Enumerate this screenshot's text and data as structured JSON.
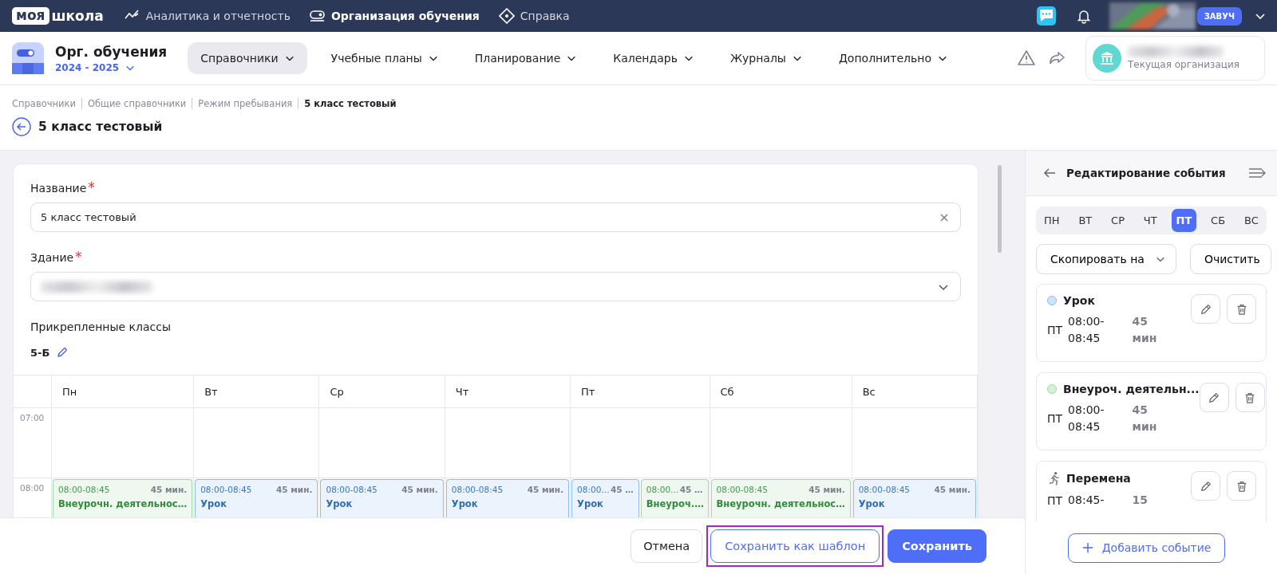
{
  "topbar": {
    "logo": {
      "part_1": "моя",
      "part_2": "школа"
    },
    "nav": [
      {
        "label": "Аналитика и отчетность",
        "selected": false
      },
      {
        "label": "Организация обучения",
        "selected": true
      },
      {
        "label": "Справка",
        "selected": false
      }
    ],
    "role_badge": "ЗАВУЧ"
  },
  "header": {
    "module_title": "Орг. обучения",
    "year": "2024 - 2025",
    "menu": [
      {
        "label": "Справочники",
        "selected": true
      },
      {
        "label": "Учебные планы",
        "selected": false
      },
      {
        "label": "Планирование",
        "selected": false
      },
      {
        "label": "Календарь",
        "selected": false
      },
      {
        "label": "Журналы",
        "selected": false
      },
      {
        "label": "Дополнительно",
        "selected": false
      }
    ],
    "organization_caption": "Текущая организация"
  },
  "breadcrumbs": [
    {
      "label": "Справочники",
      "current": false
    },
    {
      "label": "Общие справочники",
      "current": false
    },
    {
      "label": "Режим пребывания",
      "current": false
    },
    {
      "label": "5 класс тестовый",
      "current": true
    }
  ],
  "page_title": "5 класс тестовый",
  "form": {
    "name_label": "Название",
    "name_required_mark": "*",
    "name_value": "5 класс тестовый",
    "building_label": "Здание",
    "building_required_mark": "*",
    "classes_label": "Прикрепленные классы",
    "classes_value": "5-Б"
  },
  "calendar": {
    "days": [
      {
        "label": "Пн",
        "events": [
          {
            "kind": "extra",
            "time": "08:00-08:45",
            "duration": "45 мин.",
            "title": "Внеурочн. деятельнос…"
          }
        ]
      },
      {
        "label": "Вт",
        "events": [
          {
            "kind": "lesson",
            "time": "08:00-08:45",
            "duration": "45 мин.",
            "title": "Урок"
          }
        ]
      },
      {
        "label": "Ср",
        "events": [
          {
            "kind": "lesson",
            "time": "08:00-08:45",
            "duration": "45 мин.",
            "title": "Урок"
          }
        ]
      },
      {
        "label": "Чт",
        "events": [
          {
            "kind": "lesson",
            "time": "08:00-08:45",
            "duration": "45 мин.",
            "title": "Урок"
          }
        ]
      },
      {
        "label": "Пт",
        "events": [
          {
            "kind": "lesson",
            "time": "08:00…",
            "duration": "45 …",
            "title": "Урок"
          },
          {
            "kind": "extra",
            "time": "08:00…",
            "duration": "45 …",
            "title": "Внеуроч.…"
          }
        ]
      },
      {
        "label": "Сб",
        "events": [
          {
            "kind": "extra",
            "time": "08:00-08:45",
            "duration": "45 мин.",
            "title": "Внеурочн. деятельнос…"
          }
        ]
      },
      {
        "label": "Вс",
        "events": [
          {
            "kind": "lesson",
            "time": "08:00-08:45",
            "duration": "45 мин.",
            "title": "Урок"
          }
        ]
      }
    ],
    "hours": [
      "07:00",
      "08:00"
    ]
  },
  "footer": {
    "buttons": [
      {
        "label": "Отмена",
        "kind": "plain",
        "highlighted": false
      },
      {
        "label": "Сохранить как шаблон",
        "kind": "outline",
        "highlighted": true
      },
      {
        "label": "Сохранить",
        "kind": "primary",
        "highlighted": false
      }
    ]
  },
  "panel": {
    "title": "Редактирование события",
    "days": [
      {
        "label": "ПН",
        "selected": false
      },
      {
        "label": "ВТ",
        "selected": false
      },
      {
        "label": "СР",
        "selected": false
      },
      {
        "label": "ЧТ",
        "selected": false
      },
      {
        "label": "ПТ",
        "selected": true
      },
      {
        "label": "СБ",
        "selected": false
      },
      {
        "label": "ВС",
        "selected": false
      }
    ],
    "copy_button": "Скопировать на",
    "clear_button": "Очистить",
    "events": [
      {
        "kind": "lesson",
        "title": "Урок",
        "day": "ПТ",
        "time_1": "08:00-",
        "time_2": "08:45",
        "duration_1": "45",
        "duration_2": "мин"
      },
      {
        "kind": "extra",
        "title": "Внеуроч. деятельн...",
        "day": "ПТ",
        "time_1": "08:00-",
        "time_2": "08:45",
        "duration_1": "45",
        "duration_2": "мин"
      },
      {
        "kind": "break",
        "title": "Перемена",
        "day": "ПТ",
        "time_1": "08:45-",
        "duration_1": "15"
      }
    ],
    "add_button": "Добавить событие"
  }
}
